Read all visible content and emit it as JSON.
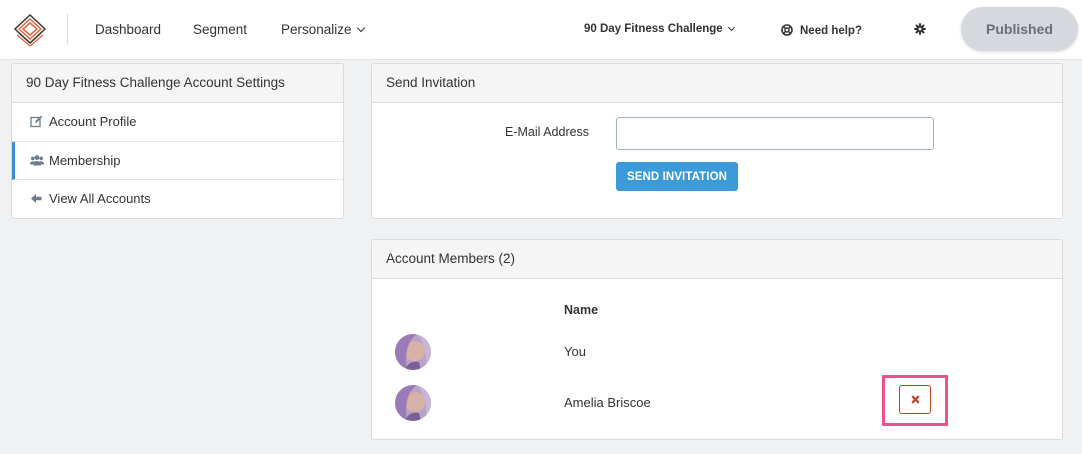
{
  "topbar": {
    "logo_icon": "layered-diamond-logo",
    "nav": [
      {
        "label": "Dashboard"
      },
      {
        "label": "Segment"
      },
      {
        "label": "Personalize",
        "has_dropdown": true
      }
    ],
    "account_name": "90 Day Fitness Challenge",
    "help_label": "Need help?",
    "help_icon": "lifebuoy-icon",
    "settings_icon": "gear-icon",
    "publish_label": "Published"
  },
  "sidebar": {
    "title": "90 Day Fitness Challenge Account Settings",
    "items": [
      {
        "label": "Account Profile",
        "icon": "edit-icon",
        "active": false
      },
      {
        "label": "Membership",
        "icon": "users-icon",
        "active": true
      },
      {
        "label": "View All Accounts",
        "icon": "arrow-left-icon",
        "active": false
      }
    ]
  },
  "invite": {
    "title": "Send Invitation",
    "email_label": "E-Mail Address",
    "email_value": "",
    "send_label": "SEND INVITATION"
  },
  "members": {
    "title": "Account Members (2)",
    "column_name": "Name",
    "rows": [
      {
        "name": "You",
        "removable": false
      },
      {
        "name": "Amelia Briscoe",
        "removable": true,
        "remove_icon": "close-icon"
      }
    ]
  },
  "colors": {
    "accent": "#3b9bd8",
    "highlight": "#ee4f8e",
    "danger": "#b8472a",
    "logo_orange": "#e8643c"
  }
}
